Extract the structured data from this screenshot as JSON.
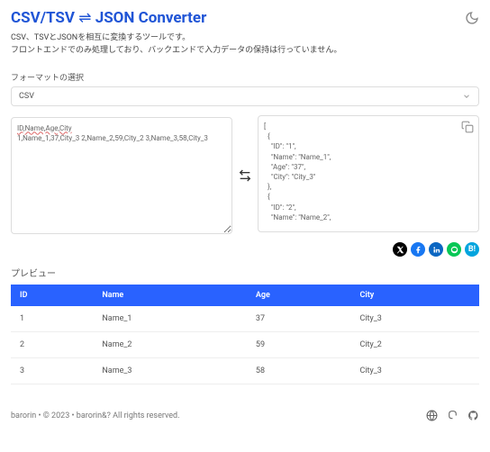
{
  "header": {
    "title_left": "CSV/TSV",
    "title_arrows": "⇌",
    "title_right": "JSON Converter"
  },
  "description": {
    "line1": "CSV、TSVとJSONを相互に変換するツールです。",
    "line2": "フロントエンドでのみ処理しており、バックエンドで入力データの保持は行っていません。"
  },
  "format": {
    "label": "フォーマットの選択",
    "selected": "CSV"
  },
  "input": {
    "header_line": "ID,Name,Age,City",
    "rest": "1,Name_1,37,City_3\n2,Name_2,59,City_2\n3,Name_3,58,City_3"
  },
  "output": {
    "text": "[\n  {\n    \"ID\": \"1\",\n    \"Name\": \"Name_1\",\n    \"Age\": \"37\",\n    \"City\": \"City_3\"\n  },\n  {\n    \"ID\": \"2\",\n    \"Name\": \"Name_2\","
  },
  "socials": {
    "colors": {
      "x": "#000",
      "fb": "#1877f2",
      "in": "#0a66c2",
      "line": "#06c755",
      "hb": "#00a4de"
    }
  },
  "preview": {
    "label": "プレビュー",
    "columns": [
      "ID",
      "Name",
      "Age",
      "City"
    ],
    "rows": [
      [
        "1",
        "Name_1",
        "37",
        "City_3"
      ],
      [
        "2",
        "Name_2",
        "59",
        "City_2"
      ],
      [
        "3",
        "Name_3",
        "58",
        "City_3"
      ]
    ]
  },
  "footer": {
    "text": "barorin • © 2023 • barorin&? All rights reserved."
  }
}
